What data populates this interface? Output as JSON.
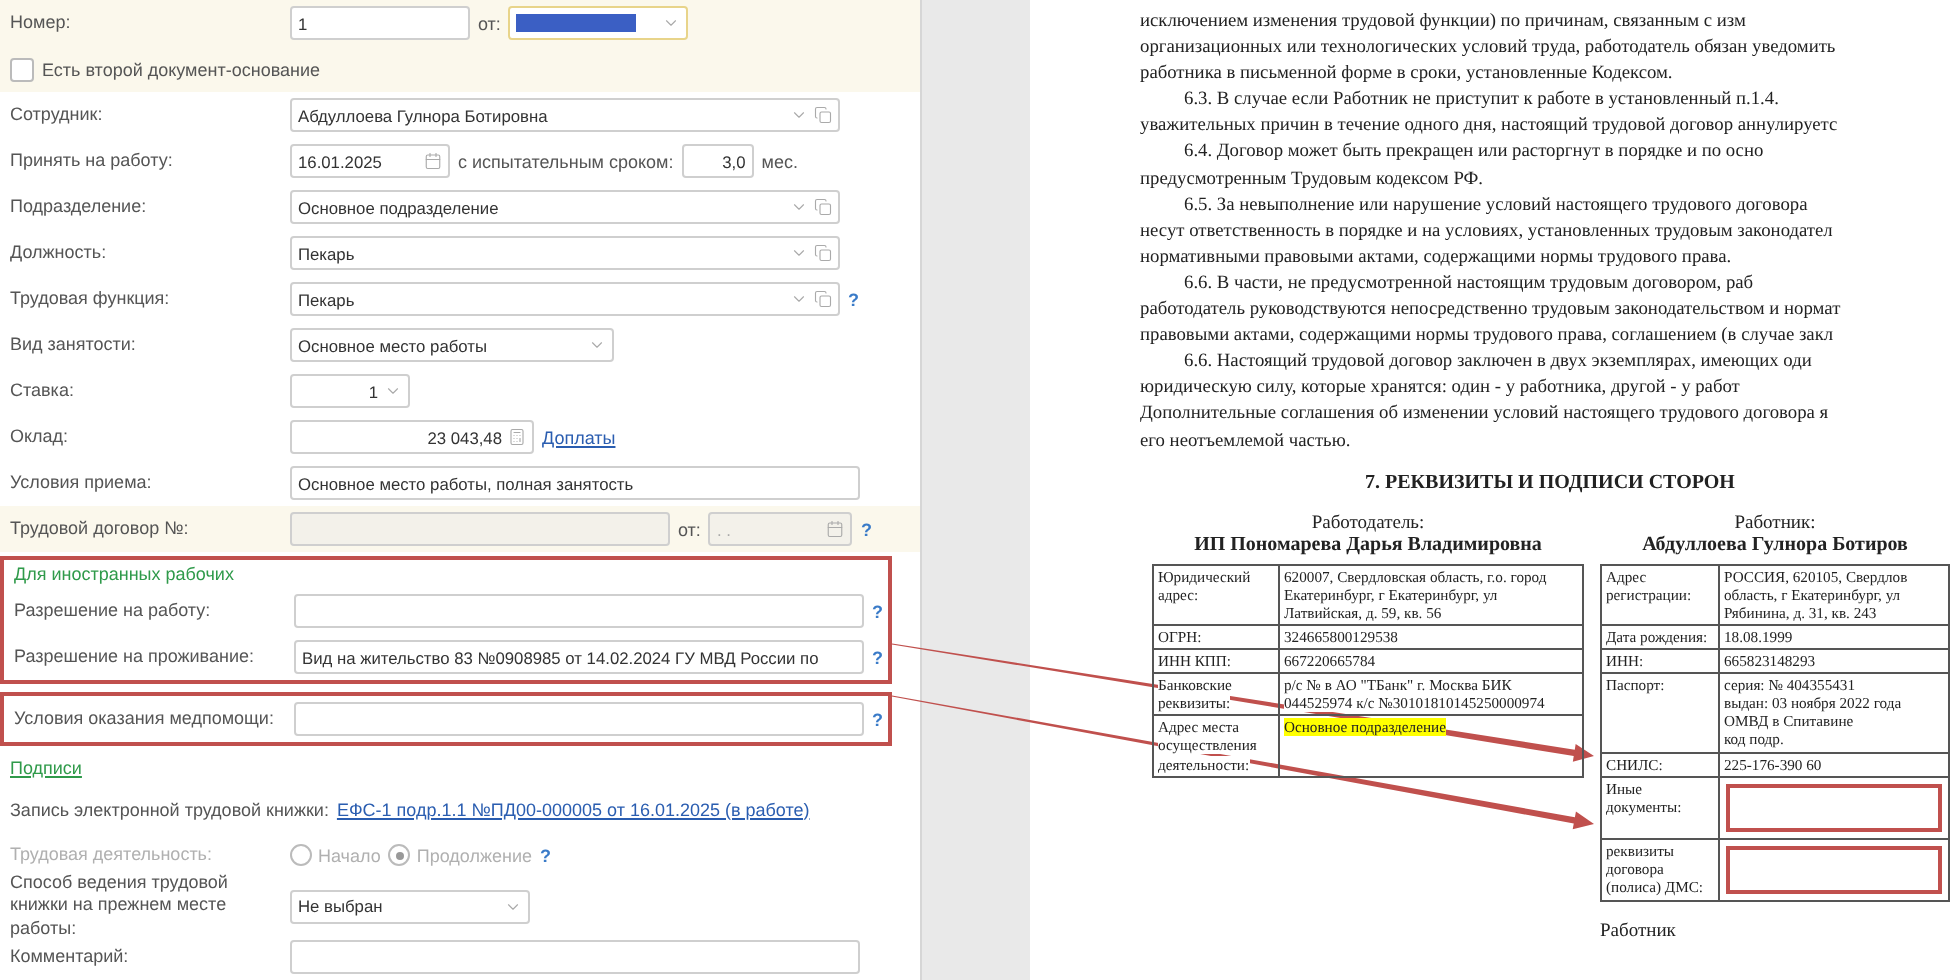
{
  "form": {
    "rows": [
      {
        "kind": "number",
        "label": "Номер:",
        "value": "1",
        "date_label": "от:"
      },
      {
        "kind": "checkbox",
        "label": "Есть второй документ-основание",
        "checked": false
      },
      {
        "kind": "select",
        "label": "Сотрудник:",
        "value": "Абдуллоева Гулнора Ботировна"
      },
      {
        "kind": "hire",
        "label": "Принять на работу:",
        "value": "16.01.2025",
        "probation_label": "с испытательным сроком:",
        "probation": "3,0",
        "unit": "мес."
      },
      {
        "kind": "select",
        "label": "Подразделение:",
        "value": "Основное подразделение"
      },
      {
        "kind": "select",
        "label": "Должность:",
        "value": "Пекарь"
      },
      {
        "kind": "select",
        "label": "Трудовая функция:",
        "value": "Пекарь",
        "help": "?"
      },
      {
        "kind": "short_select",
        "label": "Вид занятости:",
        "value": "Основное место работы"
      },
      {
        "kind": "rate",
        "label": "Ставка:",
        "value": "1"
      },
      {
        "kind": "salary",
        "label": "Оклад:",
        "value": "23 043,48",
        "link": "Доплаты"
      },
      {
        "kind": "field",
        "label": "Условия приема:",
        "value": "Основное место работы, полная занятость"
      },
      {
        "kind": "contract",
        "label": "Трудовой договор №:",
        "date_label": "от:",
        "date_placeholder": ". .",
        "help": "?"
      },
      {
        "kind": "frame",
        "rows": [
          {
            "kind": "heading",
            "text": "Для иностранных рабочих"
          },
          {
            "kind": "field",
            "label": "Разрешение на работу:",
            "value": "",
            "help": "?"
          },
          {
            "kind": "field",
            "label": "Разрешение на проживание:",
            "value": "Вид на жительство 83 №0908985 от 14.02.2024 ГУ МВД России по",
            "help": "?"
          }
        ]
      },
      {
        "kind": "frame",
        "rows": [
          {
            "kind": "field",
            "label": "Условия оказания медпомощи:",
            "value": "",
            "help": "?"
          }
        ]
      },
      {
        "kind": "link_heading",
        "text": "Подписи"
      },
      {
        "kind": "record",
        "label": "Запись электронной трудовой книжки:",
        "link": "ЕФС-1 подр.1.1 №ПД00-000005 от 16.01.2025 (в работе)"
      },
      {
        "kind": "radio",
        "label": "Трудовая деятельность:",
        "disabled": true,
        "help": "?",
        "options": [
          {
            "label": "Начало",
            "selected": false
          },
          {
            "label": "Продолжение",
            "selected": true
          }
        ]
      },
      {
        "kind": "short_select",
        "label": "Способ ведения трудовой книжки на прежнем месте работы:",
        "value": "Не выбран"
      },
      {
        "kind": "field",
        "label": "Комментарий:",
        "value": ""
      }
    ]
  },
  "document": {
    "lines": [
      {
        "text": "исключением изменения трудовой функции) по причинам, связанным с изм",
        "indent": false
      },
      {
        "text": "организационных или технологических условий труда, работодатель обязан уведомить",
        "indent": false
      },
      {
        "text": "работника в письменной форме в сроки, установленные Кодексом.",
        "indent": false
      },
      {
        "text": "6.3. В случае если Работник не приступит к работе в установленный п.1.4.",
        "indent": true
      },
      {
        "text": "уважительных причин в течение одного дня, настоящий трудовой договор аннулируетс",
        "indent": false
      },
      {
        "text": "6.4. Договор может быть прекращен или расторгнут в порядке и по осно",
        "indent": true
      },
      {
        "text": "предусмотренным Трудовым кодексом РФ.",
        "indent": false
      },
      {
        "text": "6.5. За невыполнение или нарушение условий настоящего трудового договора",
        "indent": true
      },
      {
        "text": "несут ответственность в порядке и на условиях, установленных трудовым законодател",
        "indent": false
      },
      {
        "text": "нормативными правовыми актами, содержащими нормы трудового права.",
        "indent": false
      },
      {
        "text": "6.6. В части, не предусмотренной настоящим трудовым договором, раб",
        "indent": true
      },
      {
        "text": "работодатель руководствуются непосредственно трудовым законодательством и нормат",
        "indent": false
      },
      {
        "text": "правовыми актами, содержащими нормы трудового права, соглашением (в случае закл",
        "indent": false
      },
      {
        "text": "6.6. Настоящий трудовой договор заключен в двух экземплярах, имеющих оди",
        "indent": true
      },
      {
        "text": "юридическую силу, которые хранятся: один - у работника, другой - у работ",
        "indent": false
      },
      {
        "text": "Дополнительные соглашения об изменении условий настоящего трудового договора я",
        "indent": false
      },
      {
        "text": "его неотъемлемой частью.",
        "indent": false
      }
    ],
    "heading": "7. РЕКВИЗИТЫ И ПОДПИСИ СТОРОН",
    "employer": {
      "role": "Работодатель:",
      "name": "ИП Пономарева Дарья Владимировна",
      "rows": [
        {
          "label": "Юридический адрес:",
          "value": "620007, Свердловская область, г.о. город Екатеринбург, г Екатеринбург, ул Латвийская, д. 59, кв. 56",
          "highlighted": false
        },
        {
          "label": "ОГРН:",
          "value": "324665800129538",
          "highlighted": false
        },
        {
          "label": "ИНН КПП:",
          "value": "667220665784",
          "highlighted": false
        },
        {
          "label": "Банковские реквизиты:",
          "value": "р/с № в АО \"ТБанк\" г. Москва БИК 044525974 к/с №30101810145250000974",
          "highlighted": false
        },
        {
          "label": "Адрес места осуществления деятельности:",
          "value": "Основное подразделение",
          "highlighted": true
        }
      ]
    },
    "employee": {
      "role": "Работник:",
      "name": "Абдуллоева Гулнора Ботиров",
      "rows": [
        {
          "kind": "text",
          "label": "Адрес регистрации:",
          "lines": [
            "РОССИЯ, 620105, Свердлов",
            "область, г Екатеринбург, ул",
            "Рябинина, д. 31, кв. 243"
          ]
        },
        {
          "kind": "text",
          "label": "Дата рождения:",
          "lines": [
            "18.08.1999"
          ]
        },
        {
          "kind": "text",
          "label": "ИНН:",
          "lines": [
            "665823148293"
          ]
        },
        {
          "kind": "text",
          "label": "Паспорт:",
          "lines": [
            "серия: № 404355431",
            "выдан: 03 ноября 2022 года",
            "ОМВД в Спитавине",
            "код подр."
          ]
        },
        {
          "kind": "text",
          "label": "СНИЛС:",
          "lines": [
            "225-176-390 60"
          ]
        },
        {
          "kind": "marked",
          "label": "Иные документы:"
        },
        {
          "kind": "marked",
          "label": "реквизиты договора (полиса) ДМС:"
        }
      ]
    },
    "signature": "Работник"
  }
}
